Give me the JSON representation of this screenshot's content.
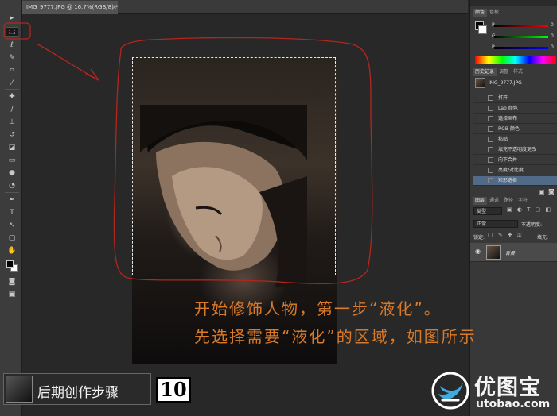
{
  "document": {
    "tab_title": "IMG_9777.JPG @ 16.7%(RGB/8) *",
    "close_glyph": "×"
  },
  "toolbar": {
    "tools": [
      "move-tool",
      "rect-marquee-tool",
      "lasso-tool",
      "quick-select-tool",
      "crop-tool",
      "eyedropper-tool",
      "healing-brush-tool",
      "brush-tool",
      "clone-stamp-tool",
      "history-brush-tool",
      "eraser-tool",
      "gradient-tool",
      "blur-tool",
      "dodge-tool",
      "pen-tool",
      "type-tool",
      "path-select-tool",
      "shape-tool",
      "hand-tool",
      "zoom-tool"
    ],
    "selected_tool": "rect-marquee-tool"
  },
  "color_panel": {
    "tabs": [
      "颜色",
      "色板"
    ],
    "channels": [
      "R",
      "G",
      "B"
    ],
    "values": [
      0,
      0,
      0
    ],
    "fg_color": "#000000"
  },
  "history_panel": {
    "tabs": [
      "历史记录",
      "调整",
      "样式"
    ],
    "snapshot": "IMG_9777.JPG",
    "items": [
      "打开",
      "Lab 颜色",
      "选择画布",
      "RGB 颜色",
      "粘贴",
      "填充不透明度更改",
      "向下合并",
      "亮度/对比度",
      "矩形选框"
    ],
    "active_index": 8
  },
  "layers_panel": {
    "tabs": [
      "图层",
      "通道",
      "路径",
      "字符"
    ],
    "filter_kind": "类型",
    "blend_mode": "正常",
    "opacity_label": "不透明度:",
    "lock_label": "锁定:",
    "fill_label": "填充:",
    "layer_name": "背景"
  },
  "caption": {
    "line1": "开始修饰人物，第一步“液化”。",
    "line2": "先选择需要“液化”的区域，如图所示"
  },
  "step_badge": {
    "label": "后期创作步骤",
    "number": "10"
  },
  "watermark": {
    "name": "优图宝",
    "url": "utobao.com"
  },
  "colors": {
    "accent_orange": "#d97a2a",
    "annotation_red": "#b3261e",
    "history_active": "#516a88"
  }
}
